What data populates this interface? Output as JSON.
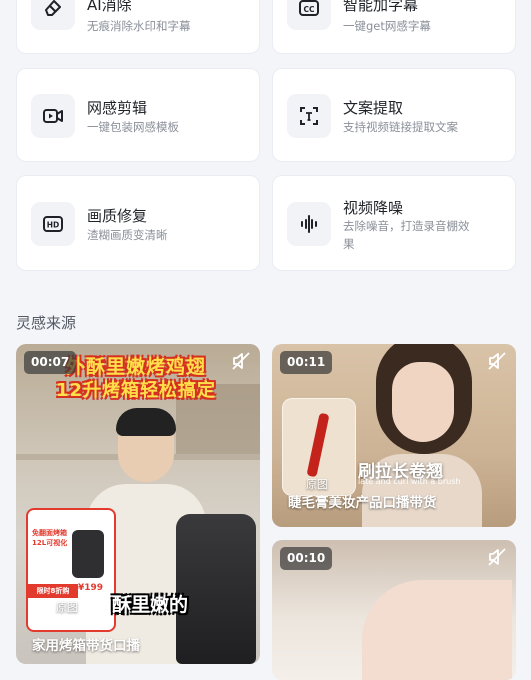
{
  "tools": [
    {
      "title": "AI消除",
      "desc": "无痕消除水印和字幕",
      "icon": "eraser-icon"
    },
    {
      "title": "智能加字幕",
      "desc": "一键get网感字幕",
      "icon": "cc-icon"
    },
    {
      "title": "网感剪辑",
      "desc": "一键包装网感模板",
      "icon": "video-clip-icon"
    },
    {
      "title": "文案提取",
      "desc": "支持视频链接提取文案",
      "icon": "text-extract-icon"
    },
    {
      "title": "画质修复",
      "desc": "渣糊画质变清晰",
      "icon": "hd-icon"
    },
    {
      "title": "视频降噪",
      "desc": "去除噪音，打造录音棚效果",
      "icon": "sound-wave-icon"
    }
  ],
  "section": {
    "title": "灵感来源"
  },
  "videos": [
    {
      "duration": "00:07",
      "overlay_line1": "外酥里嫩烤鸡翅",
      "overlay_line2": "12升烤箱轻松搞定",
      "badge1": "免翻面烤箱",
      "badge2": "12L可视化",
      "price_tag": "限时8折购",
      "price": "¥199",
      "subtitle": "酥里嫩的",
      "tag": "原图",
      "caption": "家用烤箱带货口播",
      "icon": "mute-icon"
    },
    {
      "duration": "00:11",
      "overlay_line1": "刷拉长卷翘",
      "overlay_line2": "late and curl with a brush",
      "tag": "原图",
      "caption": "睫毛膏美妆产品口播带货",
      "icon": "mute-icon"
    },
    {
      "duration": "00:10",
      "icon": "mute-icon"
    }
  ]
}
